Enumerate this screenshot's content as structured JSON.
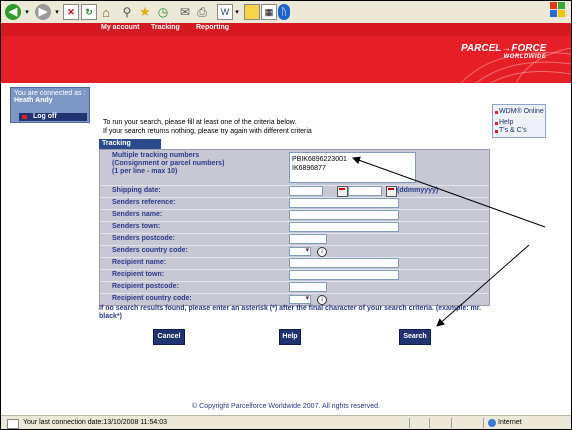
{
  "nav": {
    "my_account": "My account",
    "tracking": "Tracking",
    "reporting": "Reporting"
  },
  "brand": {
    "name": "PARCEL→FORCE",
    "sub": "WORLDWIDE"
  },
  "user": {
    "connected_label": "You are connected as :",
    "name": "Heath Andy",
    "logoff": "Log off"
  },
  "right_links": {
    "wdm": "WDM® Online",
    "help": "Help",
    "terms": "T's & C's"
  },
  "intro": {
    "line1": "To run your search, please fill at least one of the criteria below.",
    "line2": "If your search returns nothing, please try again with different criteria"
  },
  "form": {
    "tab": "Tracking",
    "multi_label_1": "Multiple tracking numbers",
    "multi_label_2": "(Consignment or parcel numbers)",
    "multi_label_3": "(1 per line - max 10)",
    "multi_value_1": "PBIK6896223001",
    "multi_value_2": "IK6896877",
    "shipping_date": "Shipping date:",
    "date_format": "(ddmmyyyy)",
    "senders_reference": "Senders reference:",
    "senders_name": "Senders name:",
    "senders_town": "Senders town:",
    "senders_postcode": "Senders postcode:",
    "senders_country": "Senders country code:",
    "recipient_name": "Recipient name:",
    "recipient_town": "Recipient town:",
    "recipient_postcode": "Recipient postcode:",
    "recipient_country": "Recipient country code:"
  },
  "note": "If no search results found, please enter an asterisk (*) after the final character of your search criteria. (example: mr. black*)",
  "buttons": {
    "cancel": "Cancel",
    "help": "Help",
    "search": "Search"
  },
  "copyright": "© Copyright Parcelforce Worldwide 2007. All rights reserved.",
  "status": {
    "text": "Your last connection date:13/10/2008 11:54:03",
    "zone": "Internet"
  },
  "colors": {
    "brand_red": "#e61f26",
    "navy": "#1f3470"
  }
}
